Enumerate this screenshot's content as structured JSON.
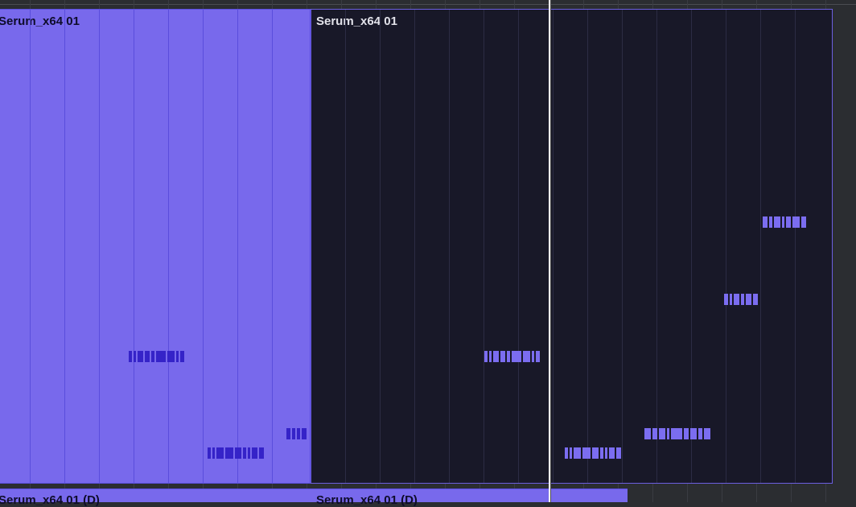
{
  "colors": {
    "selected_clip_fill": "#7869ec",
    "unselected_clip_fill": "#181828",
    "note_on_selected": "#3523c8",
    "note_on_unselected": "#7b6df0",
    "playhead": "#f2f2f2"
  },
  "clips": [
    {
      "name": "Serum_x64 01",
      "state": "selected"
    },
    {
      "name": "Serum_x64 01",
      "state": "unselected"
    }
  ],
  "lower_clips": [
    {
      "name": "Serum_x64 01 (D)"
    },
    {
      "name": "Serum_x64 01 (D)"
    }
  ]
}
